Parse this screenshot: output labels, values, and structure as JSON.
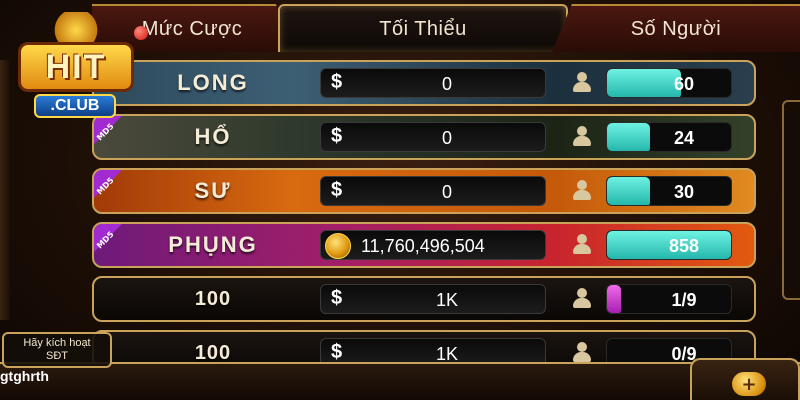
{
  "tabs": {
    "bet_level": "Mức Cược",
    "minimum": "Tối Thiểu",
    "players": "Số Người"
  },
  "logo": {
    "hit": "HIT",
    "club": ".CLUB"
  },
  "rows": [
    {
      "name": "LONG",
      "badge": "",
      "bet": "0",
      "players": "60",
      "fill": 0.6,
      "fill_color": "#3fd6c8"
    },
    {
      "name": "HỔ",
      "badge": "MD5",
      "bet": "0",
      "players": "24",
      "fill": 0.35,
      "fill_color": "#3fd6c8"
    },
    {
      "name": "SƯ",
      "badge": "MD5",
      "bet": "0",
      "players": "30",
      "fill": 0.35,
      "fill_color": "#3fd6c8"
    },
    {
      "name": "PHỤNG",
      "badge": "MD5",
      "bet": "11,760,496,504",
      "players": "858",
      "fill": 1.0,
      "fill_color": "#3fd6c8"
    },
    {
      "name": "100",
      "badge": "",
      "bet": "1K",
      "players": "1/9",
      "fill": 0.11,
      "fill_color": "#c83ad6"
    },
    {
      "name": "100",
      "badge": "",
      "bet": "1K",
      "players": "0/9",
      "fill": 0.0,
      "fill_color": "#c83ad6"
    }
  ],
  "activate": {
    "line1": "Hãy kích hoạt",
    "line2": "SĐT"
  },
  "username": "gtghrth",
  "plus_icon": "+",
  "currency_symbol": "$"
}
